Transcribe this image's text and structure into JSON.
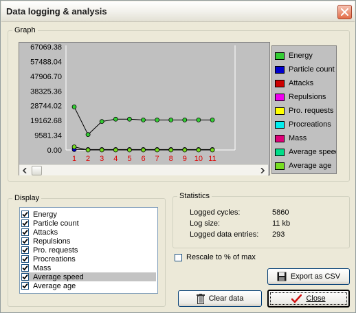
{
  "window": {
    "title": "Data logging & analysis"
  },
  "graph": {
    "legend_title": "Graph",
    "y_ticks": [
      "67069.38",
      "57488.04",
      "47906.70",
      "38325.36",
      "28744.02",
      "19162.68",
      "9581.34",
      "0.00"
    ],
    "x_ticks": [
      "1",
      "2",
      "3",
      "4",
      "5",
      "6",
      "7",
      "8",
      "9",
      "10",
      "11"
    ],
    "legend": [
      {
        "label": "Energy",
        "color": "#33cc33"
      },
      {
        "label": "Particle count",
        "color": "#0000cc"
      },
      {
        "label": "Attacks",
        "color": "#cc0000"
      },
      {
        "label": "Repulsions",
        "color": "#ee00ee"
      },
      {
        "label": "Pro. requests",
        "color": "#ffff00"
      },
      {
        "label": "Procreations",
        "color": "#00eeee"
      },
      {
        "label": "Mass",
        "color": "#dd0077"
      },
      {
        "label": "Average speed",
        "color": "#00dd88"
      },
      {
        "label": "Average age",
        "color": "#77dd22"
      }
    ]
  },
  "chart_data": {
    "type": "line",
    "categories": [
      "1",
      "2",
      "3",
      "4",
      "5",
      "6",
      "7",
      "8",
      "9",
      "10",
      "11"
    ],
    "ylim": [
      0,
      67069.38
    ],
    "series": [
      {
        "name": "Energy",
        "color": "#33cc33",
        "values": [
          28000,
          10000,
          18500,
          20000,
          20000,
          19500,
          19500,
          19500,
          19500,
          19500,
          19500
        ]
      },
      {
        "name": "Particle count",
        "color": "#0000cc",
        "values": [
          300,
          293,
          293,
          293,
          293,
          293,
          293,
          293,
          293,
          293,
          293
        ]
      },
      {
        "name": "Average age",
        "color": "#77dd22",
        "values": [
          2000,
          0,
          0,
          0,
          0,
          0,
          0,
          0,
          0,
          0,
          0
        ]
      }
    ]
  },
  "display": {
    "legend_title": "Display",
    "items": [
      {
        "label": "Energy",
        "checked": true
      },
      {
        "label": "Particle count",
        "checked": true
      },
      {
        "label": "Attacks",
        "checked": true
      },
      {
        "label": "Repulsions",
        "checked": true
      },
      {
        "label": "Pro. requests",
        "checked": true
      },
      {
        "label": "Procreations",
        "checked": true
      },
      {
        "label": "Mass",
        "checked": true
      },
      {
        "label": "Average speed",
        "checked": true
      },
      {
        "label": "Average age",
        "checked": true
      }
    ],
    "selected_index": 7
  },
  "statistics": {
    "legend_title": "Statistics",
    "rows": [
      {
        "label": "Logged cycles:",
        "value": "5860"
      },
      {
        "label": "Log size:",
        "value": "11 kb"
      },
      {
        "label": "Logged data entries:",
        "value": "293"
      }
    ]
  },
  "options": {
    "rescale_label": "Rescale to % of max",
    "rescale_checked": false
  },
  "buttons": {
    "export": "Export as CSV",
    "clear": "Clear data",
    "close": "Close"
  }
}
